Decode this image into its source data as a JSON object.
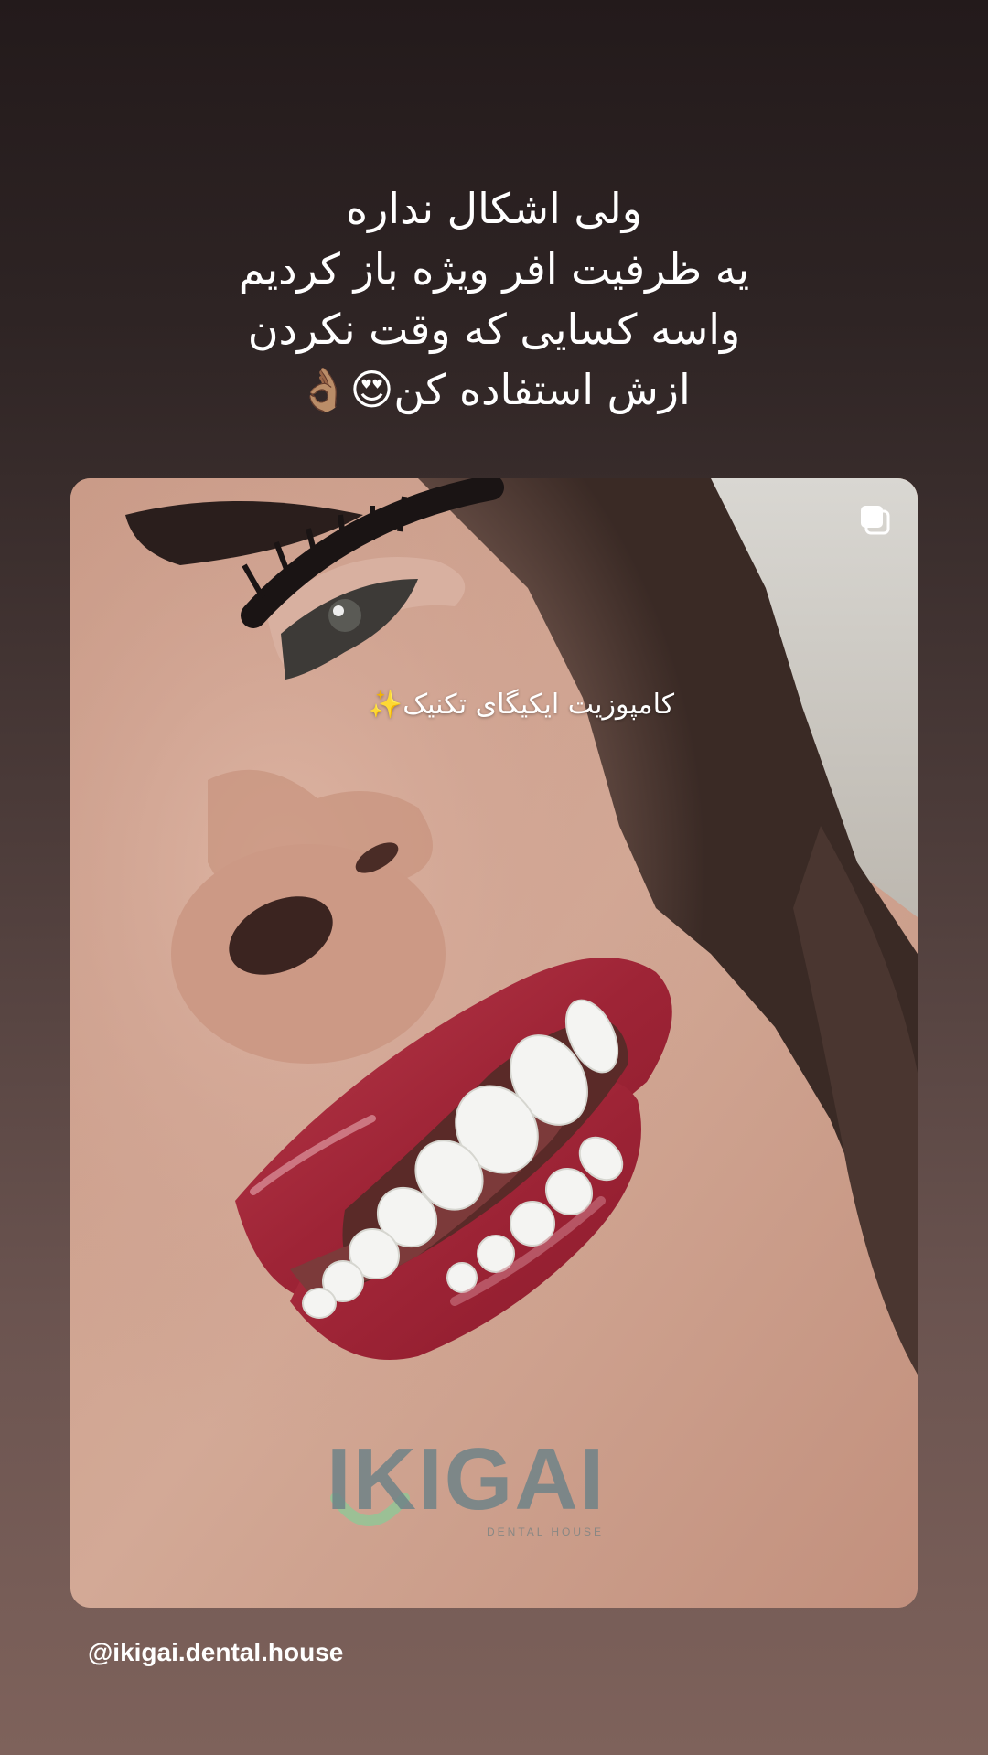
{
  "story": {
    "caption_lines": [
      "ولی اشکال نداره",
      "یه ظرفیت افر ویژه باز کردیم",
      "واسه کسایی که وقت نکردن",
      "ازش استفاده کن😍👌🏽"
    ]
  },
  "post": {
    "overlay_text": "کامپوزیت ایکیگای تکنیک✨",
    "logo_text": "IKIGAI",
    "logo_subtitle": "DENTAL HOUSE",
    "multi_post_icon": "multiple-posts-icon"
  },
  "footer": {
    "handle": "@ikigai.dental.house"
  }
}
